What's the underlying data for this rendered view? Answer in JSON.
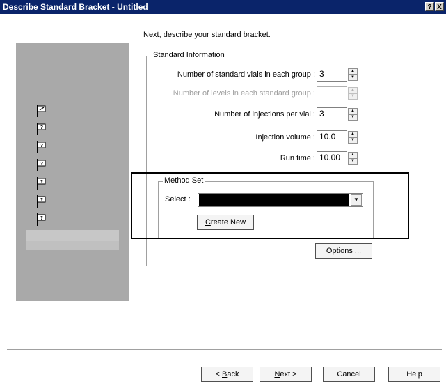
{
  "title": "Describe Standard Bracket - Untitled",
  "title_buttons": {
    "help": "?",
    "close": "X"
  },
  "intro": "Next, describe your standard bracket.",
  "standard_info": {
    "label": "Standard Information",
    "rows": [
      {
        "label": "Number of standard vials in each group :",
        "value": "3",
        "enabled": true
      },
      {
        "label": "Number of levels in each standard group :",
        "value": "",
        "enabled": false
      },
      {
        "label": "Number of injections per vial :",
        "value": "3",
        "enabled": true
      },
      {
        "label": "Injection volume :",
        "value": "10.0",
        "enabled": true
      },
      {
        "label": "Run time :",
        "value": "10.00",
        "enabled": true
      }
    ]
  },
  "method_set": {
    "label": "Method Set",
    "select_label": "Select :",
    "selected_value": "",
    "create_new": {
      "accel": "C",
      "rest": "reate New"
    }
  },
  "options_button": "Options ...",
  "footer": {
    "back": {
      "prefix": "< ",
      "accel": "B",
      "rest": "ack"
    },
    "next": {
      "accel": "N",
      "rest": "ext >"
    },
    "cancel": "Cancel",
    "help": "Help"
  },
  "steps": [
    "completed",
    "pending",
    "pending",
    "pending",
    "pending",
    "pending",
    "current"
  ],
  "colors": {
    "titlebar": "#0a246a",
    "side_panel": "#a9a9a9",
    "highlight_border": "#000000"
  }
}
